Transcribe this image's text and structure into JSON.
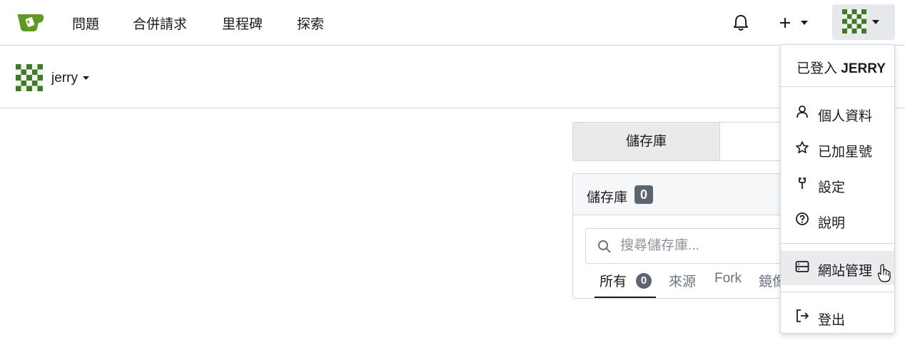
{
  "navbar": {
    "logo_icon": "gitea-logo-icon",
    "items": [
      {
        "label": "問題"
      },
      {
        "label": "合併請求"
      },
      {
        "label": "里程碑"
      },
      {
        "label": "探索"
      }
    ],
    "notification_icon": "bell-icon",
    "create_icon": "plus-icon",
    "avatar_icon": "user-avatar-icon"
  },
  "profile": {
    "username": "jerry"
  },
  "tabs": [
    {
      "label": "儲存庫",
      "active": true
    }
  ],
  "repo_panel": {
    "title": "儲存庫",
    "count": "0",
    "search": {
      "placeholder": "搜尋儲存庫...",
      "value": ""
    },
    "filters": [
      {
        "label": "所有",
        "count": "0",
        "active": true
      },
      {
        "label": "來源"
      },
      {
        "label": "Fork"
      },
      {
        "label": "鏡像"
      }
    ]
  },
  "user_dropdown": {
    "header_prefix": "已登入",
    "header_user": "JERRY",
    "items": [
      {
        "label": "個人資料",
        "icon": "person-icon"
      },
      {
        "label": "已加星號",
        "icon": "star-icon"
      },
      {
        "label": "設定",
        "icon": "tools-icon"
      },
      {
        "label": "說明",
        "icon": "question-icon"
      },
      {
        "label": "網站管理",
        "icon": "server-icon",
        "hovered": true
      },
      {
        "label": "登出",
        "icon": "sign-out-icon"
      }
    ]
  },
  "colors": {
    "brand_green": "#609926",
    "badge_gray": "#5c6470",
    "border": "#d0d7de",
    "hover_bg": "#eaebec"
  }
}
